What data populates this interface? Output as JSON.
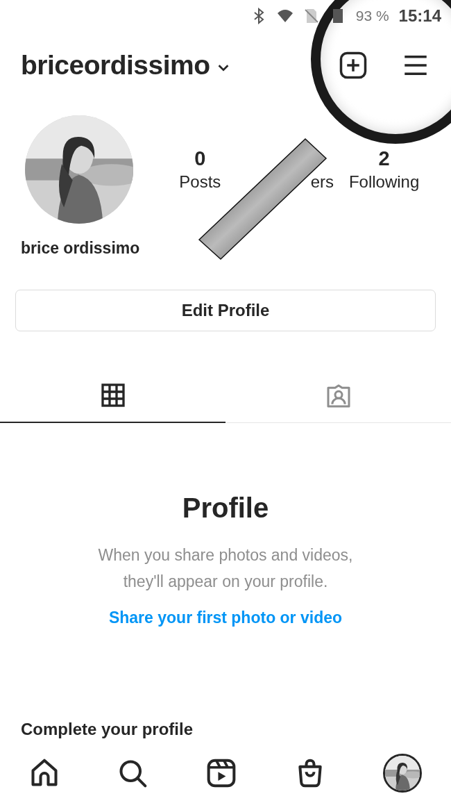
{
  "status_bar": {
    "battery": "93 %",
    "time": "15:14"
  },
  "header": {
    "username": "briceordissimo"
  },
  "profile": {
    "name": "brice ordissimo",
    "stats": [
      {
        "count": "0",
        "label": "Posts"
      },
      {
        "label": "ers"
      },
      {
        "count": "2",
        "label": "Following"
      }
    ]
  },
  "edit_button": "Edit Profile",
  "tabs": [
    {
      "kind": "grid",
      "selected": true
    },
    {
      "kind": "tagged",
      "selected": false
    }
  ],
  "empty_state": {
    "title": "Profile",
    "message_lines": [
      "When you share photos and videos,",
      "they'll appear on your profile."
    ],
    "link": "Share your first photo or video"
  },
  "section_heading": "Complete your profile",
  "bottom_nav": [
    {
      "kind": "home"
    },
    {
      "kind": "search"
    },
    {
      "kind": "reels"
    },
    {
      "kind": "shop"
    },
    {
      "kind": "profile"
    }
  ]
}
